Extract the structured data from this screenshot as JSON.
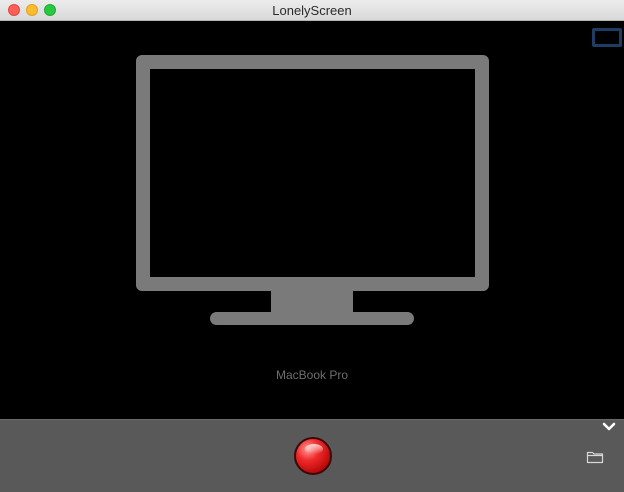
{
  "window": {
    "title": "LonelyScreen",
    "traffic_lights": {
      "close": "close-icon",
      "minimize": "minimize-icon",
      "zoom": "zoom-icon"
    }
  },
  "main": {
    "device_name": "MacBook Pro",
    "monitor_icon": "monitor-icon",
    "screen_toggle_icon": "screen-rectangle-icon"
  },
  "bottom_bar": {
    "record_icon": "record-icon",
    "expand_icon": "chevron-down-icon",
    "folder_icon": "folder-icon"
  },
  "colors": {
    "background": "#000000",
    "bottom_bar": "#595959",
    "monitor": "#7a7a7a",
    "record": "#e01818",
    "screen_toggle_border": "#1e3d62",
    "device_label": "#6e6e6e"
  }
}
